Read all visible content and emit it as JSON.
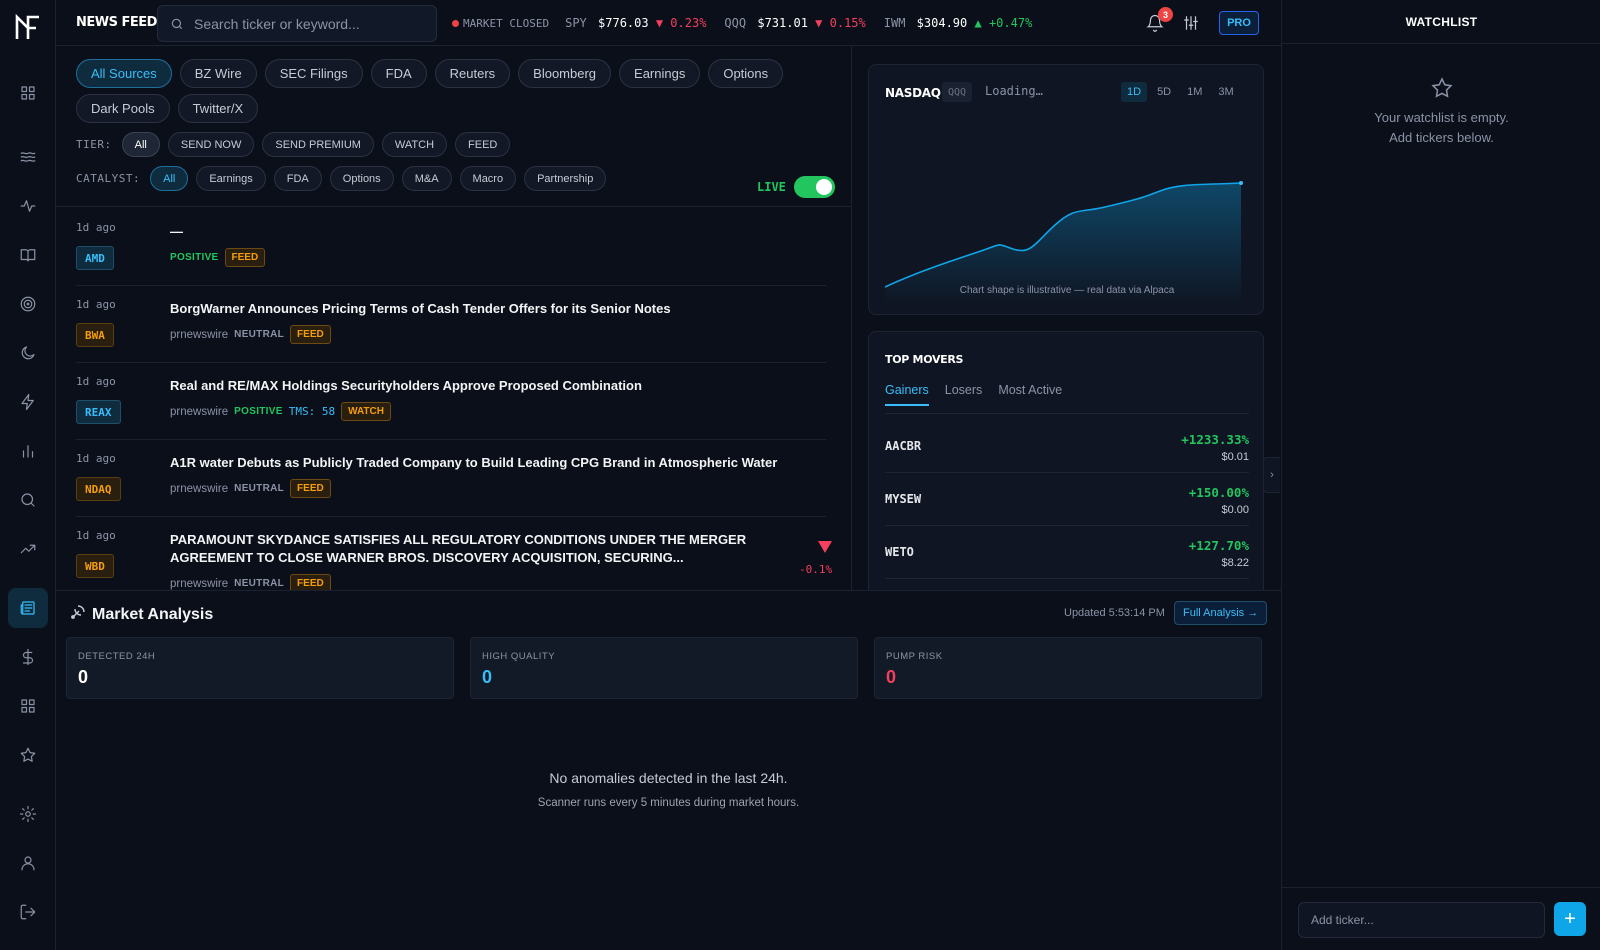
{
  "header": {
    "title": "NEWS FEED",
    "search_placeholder": "Search ticker or keyword...",
    "market_status": "MARKET CLOSED",
    "tickers": [
      {
        "symbol": "SPY",
        "price": "$776.03",
        "direction": "▼",
        "change": "0.23%"
      },
      {
        "symbol": "QQQ",
        "price": "$731.01",
        "direction": "▼",
        "change": "0.15%"
      },
      {
        "symbol": "IWM",
        "price": "$304.90",
        "direction": "▲",
        "change": "+0.47%"
      }
    ],
    "notification_count": "3",
    "pro_label": "PRO"
  },
  "sources": [
    "All Sources",
    "BZ Wire",
    "SEC Filings",
    "FDA",
    "Reuters",
    "Bloomberg",
    "Earnings",
    "Options",
    "Dark Pools",
    "Twitter/X"
  ],
  "tier": {
    "label": "TIER:",
    "options": [
      "All",
      "SEND NOW",
      "SEND PREMIUM",
      "WATCH",
      "FEED"
    ]
  },
  "catalyst": {
    "label": "CATALYST:",
    "options": [
      "All",
      "Earnings",
      "FDA",
      "Options",
      "M&A",
      "Macro",
      "Partnership"
    ]
  },
  "live_label": "LIVE",
  "news": [
    {
      "time": "1d ago",
      "ticker": "AMD",
      "headline": "—",
      "source": "",
      "sentiment": "POSITIVE",
      "tms": "",
      "tag": "FEED"
    },
    {
      "time": "1d ago",
      "ticker": "BWA",
      "headline": "BorgWarner Announces Pricing Terms of Cash Tender Offers for its Senior Notes",
      "source": "prnewswire",
      "sentiment": "NEUTRAL",
      "tms": "",
      "tag": "FEED"
    },
    {
      "time": "1d ago",
      "ticker": "REAX",
      "headline": "Real and RE/MAX Holdings Securityholders Approve Proposed Combination",
      "source": "prnewswire",
      "sentiment": "POSITIVE",
      "tms": "TMS: 58",
      "tag": "WATCH"
    },
    {
      "time": "1d ago",
      "ticker": "NDAQ",
      "headline": "A1R water Debuts as Publicly Traded Company to Build Leading CPG Brand in Atmospheric Water",
      "source": "prnewswire",
      "sentiment": "NEUTRAL",
      "tms": "",
      "tag": "FEED"
    },
    {
      "time": "1d ago",
      "ticker": "WBD",
      "headline": "PARAMOUNT SKYDANCE SATISFIES ALL REGULATORY CONDITIONS UNDER THE MERGER AGREEMENT TO CLOSE WARNER BROS. DISCOVERY ACQUISITION, SECURING...",
      "source": "prnewswire",
      "sentiment": "NEUTRAL",
      "tms": "",
      "tag": "FEED",
      "change": "-0.1%"
    }
  ],
  "chart": {
    "title": "NASDAQ",
    "symbol": "QQQ",
    "status": "Loading…",
    "ranges": [
      "1D",
      "5D",
      "1M",
      "3M"
    ],
    "active_range": "1D",
    "note": "Chart shape is illustrative — real data via Alpaca",
    "line_color": "#0ea5e9"
  },
  "movers": {
    "title": "TOP MOVERS",
    "tabs": [
      "Gainers",
      "Losers",
      "Most Active"
    ],
    "rows": [
      {
        "symbol": "AACBR",
        "change": "+1233.33%",
        "price": "$0.01"
      },
      {
        "symbol": "MYSEW",
        "change": "+150.00%",
        "price": "$0.00"
      },
      {
        "symbol": "WETO",
        "change": "+127.70%",
        "price": "$8.22"
      }
    ]
  },
  "analysis": {
    "title": "Market Analysis",
    "updated": "Updated 5:53:14 PM",
    "full_button": "Full Analysis →",
    "stats": [
      {
        "label": "DETECTED 24H",
        "value": "0",
        "color": "#ffffff"
      },
      {
        "label": "HIGH QUALITY",
        "value": "0",
        "color": "#38bdf8"
      },
      {
        "label": "PUMP RISK",
        "value": "0",
        "color": "#f43f5e"
      }
    ],
    "empty_title": "No anomalies detected in the last 24h.",
    "empty_sub": "Scanner runs every 5 minutes during market hours."
  },
  "watchlist": {
    "title": "WATCHLIST",
    "empty_line1": "Your watchlist is empty.",
    "empty_line2": "Add tickers below.",
    "input_placeholder": "Add ticker...",
    "add_label": "+"
  },
  "colors": {
    "accent": "#38bdf8",
    "positive": "#22c55e",
    "negative": "#f43f5e",
    "warning": "#f59e0b",
    "background": "#0b0f19"
  }
}
